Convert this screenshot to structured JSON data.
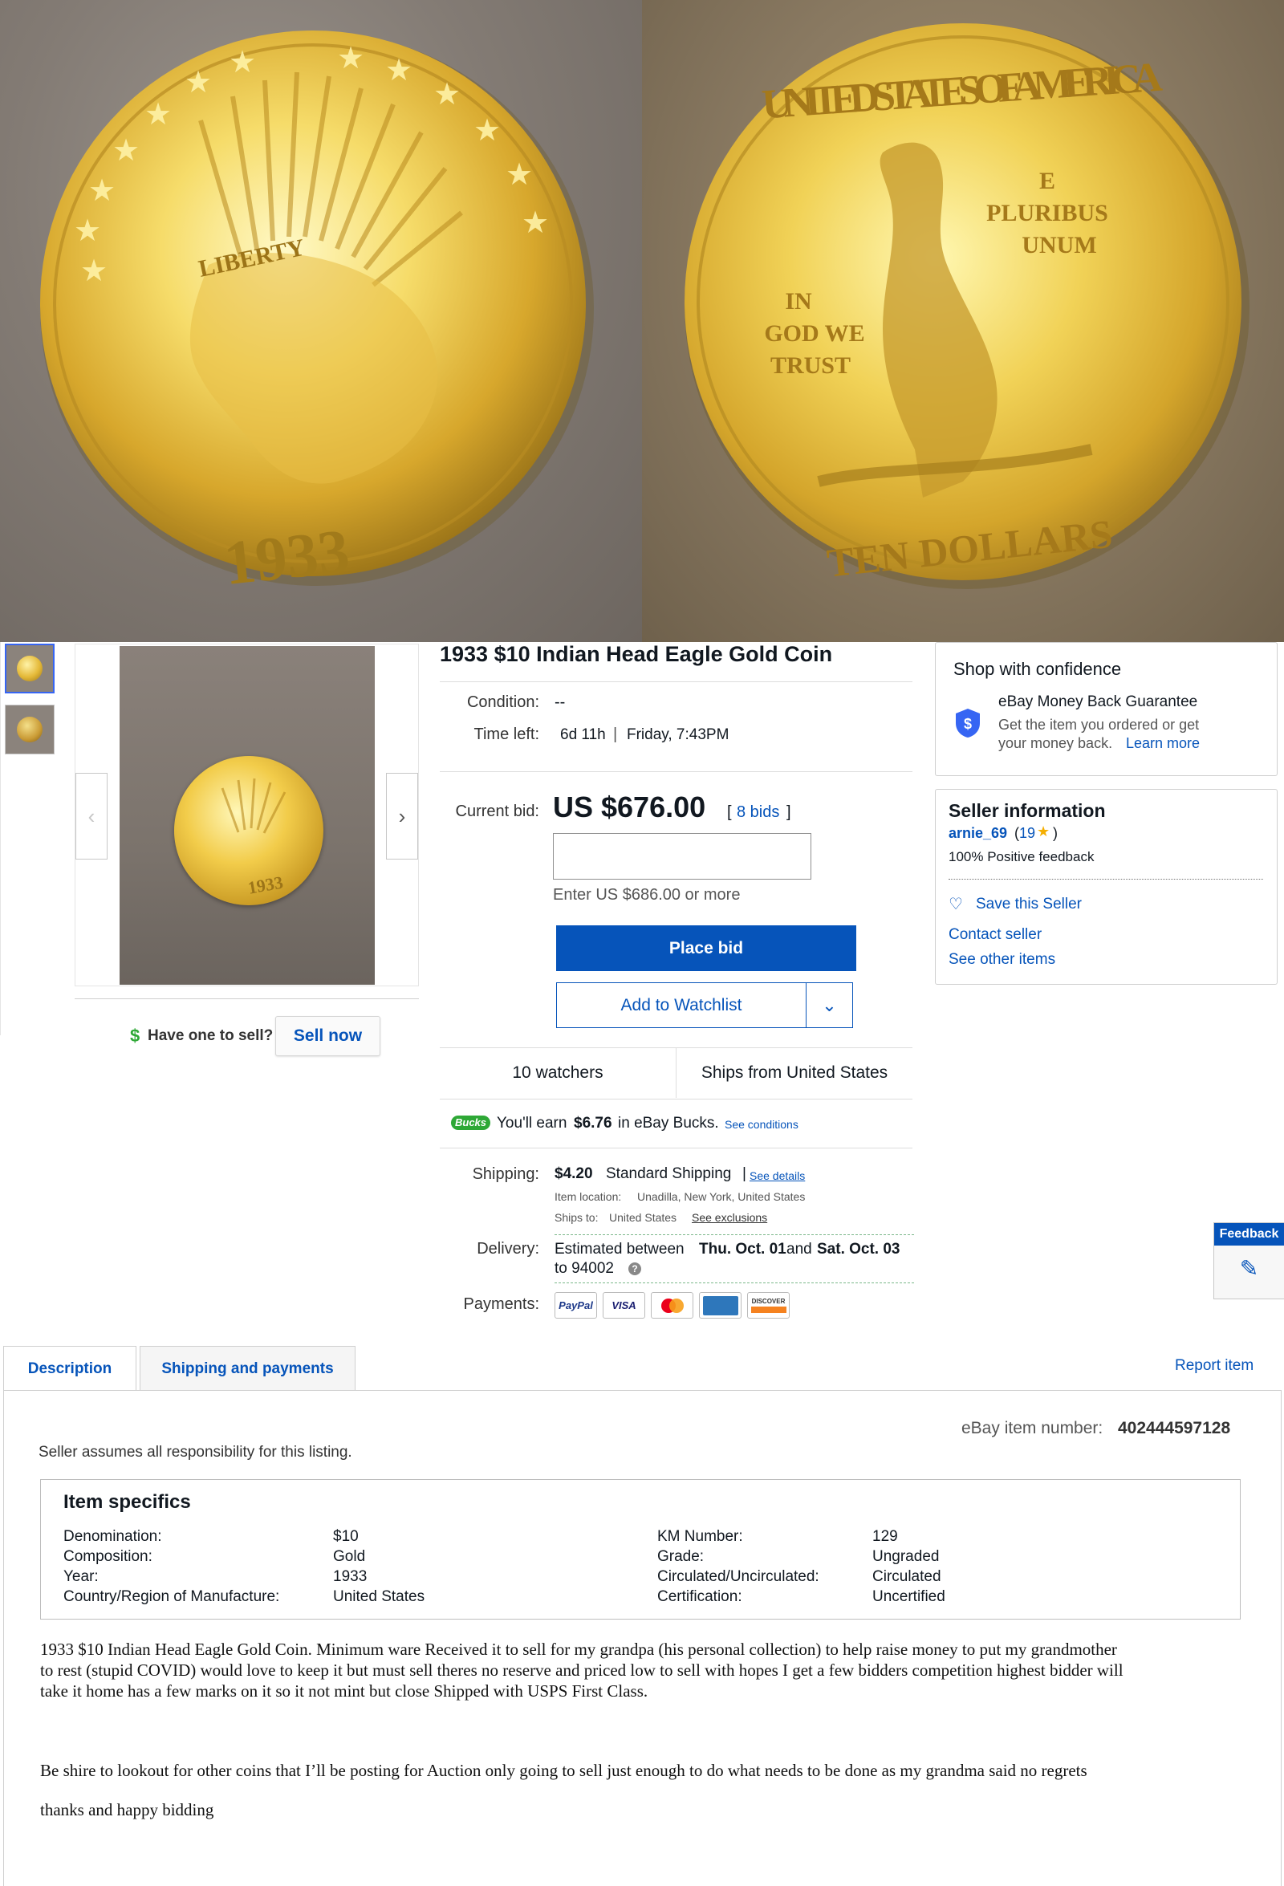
{
  "hero": {
    "obverse_year": "1933",
    "reverse_top_legend": "UNITED STATES OF AMERICA",
    "reverse_motto_1": "E",
    "reverse_motto_2": "PLURIBUS",
    "reverse_motto_3": "UNUM",
    "reverse_trust_1": "IN",
    "reverse_trust_2": "GOD WE",
    "reverse_trust_3": "TRUST",
    "reverse_bottom_legend": "TEN DOLLARS",
    "obverse_bottom_legend": "LIBERTY",
    "main_image_year": "1933"
  },
  "title": "1933 $10 Indian Head Eagle Gold Coin",
  "condition": {
    "label": "Condition:",
    "value": "--"
  },
  "time_left": {
    "label": "Time left:",
    "value": "6d 11h",
    "separator": "|",
    "end": "Friday, 7:43PM"
  },
  "bid": {
    "label": "Current bid:",
    "price": "US $676.00",
    "bids_open": "[",
    "bids_link": "8 bids",
    "bids_close": "]",
    "input_hint": "Enter US $686.00 or more",
    "place_bid": "Place bid",
    "add_watchlist": "Add to Watchlist"
  },
  "stats": {
    "watchers": "10 watchers",
    "ships_from": "Ships from United States"
  },
  "bucks": {
    "badge": "Bucks",
    "text_1": "You'll earn",
    "amount": "$6.76",
    "text_2": "in eBay Bucks.",
    "link": "See conditions"
  },
  "shipping": {
    "label": "Shipping:",
    "cost": "$4.20",
    "service": "Standard Shipping",
    "sep": "|",
    "details_link": "See details",
    "location_label": "Item location:",
    "location": "Unadilla, New York, United States",
    "ships_to_label": "Ships to:",
    "ships_to": "United States",
    "exclusions_link": "See exclusions"
  },
  "delivery": {
    "label": "Delivery:",
    "pre": "Estimated between",
    "start": "Thu. Oct. 01",
    "and": "and",
    "end": "Sat. Oct. 03",
    "to": "to 94002"
  },
  "payments": {
    "label": "Payments:",
    "methods": [
      "PayPal",
      "VISA",
      "",
      "",
      "DISCOVER"
    ]
  },
  "confidence": {
    "title": "Shop with confidence",
    "guarantee": "eBay Money Back Guarantee",
    "desc_1": "Get the item you ordered or get",
    "desc_2": "your money back.",
    "learn_more": "Learn more"
  },
  "seller": {
    "title": "Seller information",
    "name": "arnie_69",
    "score_open": "(",
    "score": "19",
    "score_close": ")",
    "positive": "100% Positive feedback",
    "save": "Save this Seller",
    "contact": "Contact seller",
    "other": "See other items"
  },
  "sell": {
    "prompt": "Have one to sell?",
    "button": "Sell now"
  },
  "feedback_tab": "Feedback",
  "tabs": {
    "description": "Description",
    "shipping": "Shipping and payments",
    "report": "Report item"
  },
  "description": {
    "item_number_label": "eBay item number:",
    "item_number": "402444597128",
    "responsibility": "Seller assumes all responsibility for this listing.",
    "specs_title": "Item specifics",
    "specs_left": [
      {
        "k": "Denomination:",
        "v": "$10"
      },
      {
        "k": "Composition:",
        "v": "Gold"
      },
      {
        "k": "Year:",
        "v": "1933"
      },
      {
        "k": "Country/Region of Manufacture:",
        "v": "United States"
      }
    ],
    "specs_right": [
      {
        "k": "KM Number:",
        "v": "129"
      },
      {
        "k": "Grade:",
        "v": "Ungraded"
      },
      {
        "k": "Circulated/Uncirculated:",
        "v": "Circulated"
      },
      {
        "k": "Certification:",
        "v": "Uncertified"
      }
    ],
    "para_1_line_1": "1933 $10 Indian Head Eagle Gold Coin. Minimum ware Received it to sell for my grandpa (his personal collection) to help raise money to put my grandmother",
    "para_1_line_2": "to rest (stupid COVID) would love to keep it but must sell theres no reserve and priced low to sell with hopes I get a few bidders competition highest bidder will",
    "para_1_line_3": "take it home has a few marks on it so it not mint but close Shipped with USPS First Class.",
    "para_2": "Be shire to lookout for other coins that I’ll be posting for Auction only going to sell just enough to do what needs to be done as my grandma said no regrets",
    "para_3": "thanks and happy bidding"
  },
  "colors": {
    "link": "#0654ba",
    "primary": "#0654ba",
    "gold": "#e4b938",
    "bucks": "#2ea836"
  }
}
